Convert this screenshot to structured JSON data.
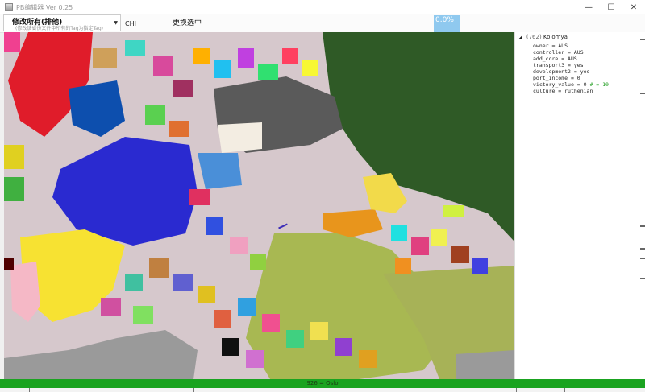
{
  "window": {
    "title": "PB编辑器 Ver 0.25",
    "minimize": "—",
    "maximize": "☐",
    "close": "✕"
  },
  "toolbar": {
    "mod_dropdown_main": "修改所有(排他)",
    "mod_dropdown_sub": "(修改该省份文件中所有的Tag为指定Tag)",
    "tag_input_value": "CHI",
    "replace_button": "更换选中",
    "progress_text": "0.0%",
    "progress_value": 0.0
  },
  "panel": {
    "province_id": "(762)",
    "province_name": "Kolomya",
    "properties": [
      {
        "text": "owner = AUS"
      },
      {
        "text": "controller = AUS"
      },
      {
        "text": "add_core = AUS"
      },
      {
        "text": "transport3 = yes"
      },
      {
        "text": "development2 = yes"
      },
      {
        "text": "port_income = 0"
      },
      {
        "text": "victory_value = 0",
        "comment": "# = 10"
      },
      {
        "text": "culture = ruthenian"
      }
    ]
  },
  "status": {
    "text": "926 = Oslo"
  },
  "colors": {
    "status_green": "#1aa320",
    "progress_blue": "#8fc9ef",
    "comment_green": "#1a9a1a"
  }
}
